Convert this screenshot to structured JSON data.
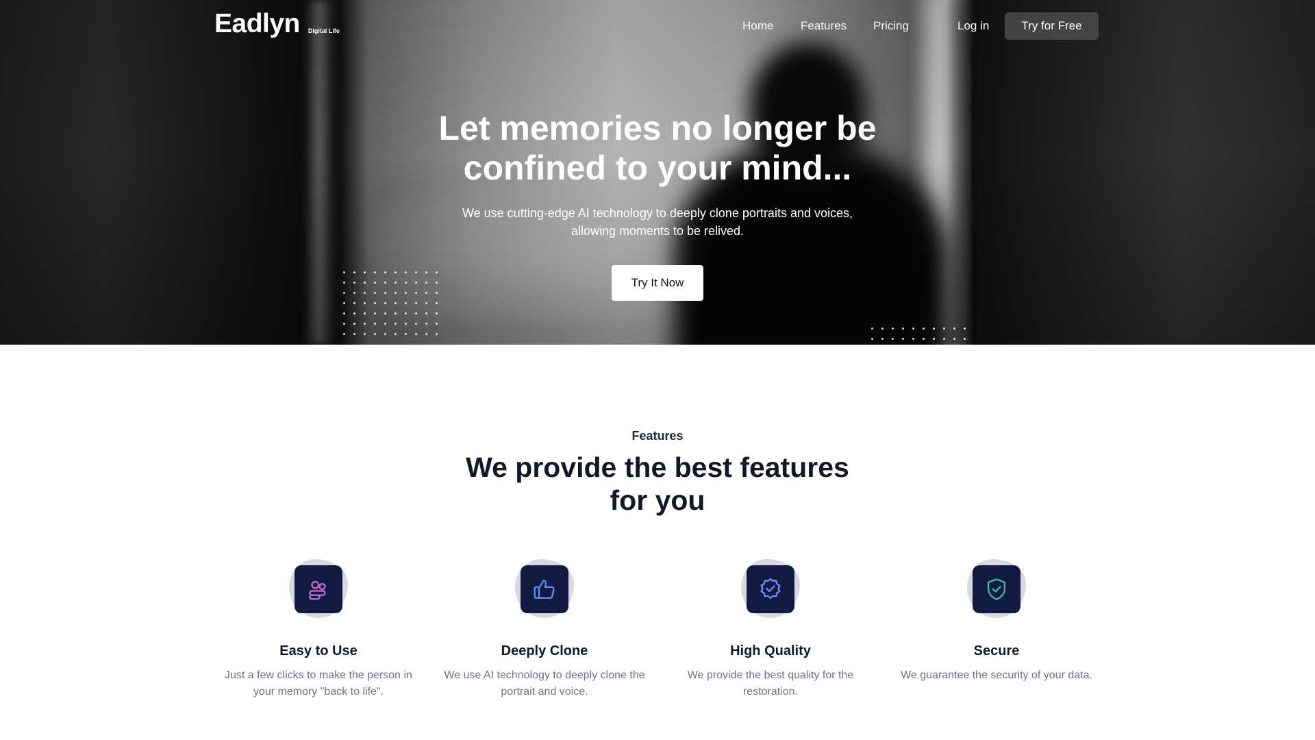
{
  "brand": {
    "name": "Eadlyn",
    "tagline": "Digital Life"
  },
  "nav": {
    "links": [
      "Home",
      "Features",
      "Pricing"
    ],
    "login": "Log in",
    "cta": "Try for Free"
  },
  "hero": {
    "title": "Let memories no longer be confined to your mind...",
    "subtitle": "We use cutting-edge AI technology to deeply clone portraits and voices, allowing moments to be relived.",
    "button": "Try It Now"
  },
  "features": {
    "eyebrow": "Features",
    "heading": "We provide the best features for you",
    "items": [
      {
        "title": "Easy to Use",
        "text": "Just a few clicks to make the person in your memory \"back to life\".",
        "icon": "users-icon",
        "icon_color": "#c06bd1"
      },
      {
        "title": "Deeply Clone",
        "text": "We use AI technology to deeply clone the portrait and voice.",
        "icon": "thumbs-up-icon",
        "icon_color": "#5b8def"
      },
      {
        "title": "High Quality",
        "text": "We provide the best quality for the restoration.",
        "icon": "badge-check-icon",
        "icon_color": "#6f8cf5"
      },
      {
        "title": "Secure",
        "text": "We guarantee the security of your data.",
        "icon": "shield-check-icon",
        "icon_color": "#3fb8a0"
      }
    ]
  },
  "colors": {
    "icon_tile": "#111a40",
    "icon_blob": "#d9d6e6",
    "heading_text": "#111827",
    "body_text": "#6b7280"
  }
}
